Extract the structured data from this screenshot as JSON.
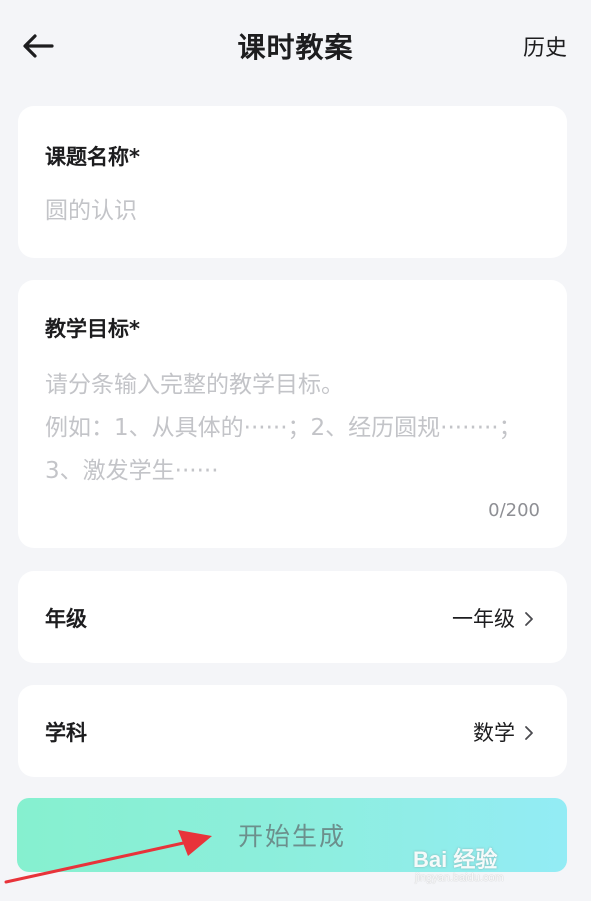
{
  "header": {
    "title": "课时教案",
    "history_label": "历史"
  },
  "topic": {
    "label": "课题名称*",
    "placeholder": "圆的认识"
  },
  "goal": {
    "label": "教学目标*",
    "placeholder": "请分条输入完整的教学目标。\n例如：1、从具体的······；2、经历圆规········；3、激发学生······",
    "counter": "0/200"
  },
  "grade": {
    "label": "年级",
    "value": "一年级"
  },
  "subject": {
    "label": "学科",
    "value": "数学"
  },
  "generate_button": {
    "label": "开始生成"
  },
  "watermark": {
    "logo": "Bai 经验",
    "url": "jingyan.baidu.com"
  },
  "colors": {
    "background": "#f4f5f8",
    "card": "#ffffff",
    "button_gradient_start": "#86f0cf",
    "button_gradient_end": "#93ecf5",
    "button_text": "#6c8f8c",
    "placeholder": "#c3c4c8",
    "annotation_arrow": "#e8333a"
  },
  "icons": {
    "back": "arrow-left-icon",
    "chevron": "chevron-right-icon",
    "annotation": "red-arrow-annotation",
    "watermark_paw": "paw-icon"
  }
}
